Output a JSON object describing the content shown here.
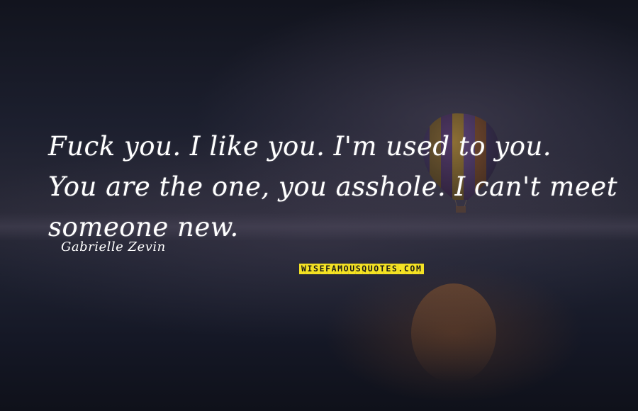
{
  "quote": {
    "lines": [
      "Fuck you. I like you. I'm used to you.",
      "You are the one, you asshole. I can't meet",
      "someone new."
    ],
    "author": "Gabrielle Zevin"
  },
  "watermark": {
    "text": "WISEFAMOUSQUOTES.COM",
    "background_color": "#f4e224",
    "text_color": "#1a1a1a"
  },
  "background": {
    "description_colors": [
      "#12141e",
      "#2a2a38",
      "#151826"
    ],
    "icon": "hot-air-balloon-icon"
  }
}
